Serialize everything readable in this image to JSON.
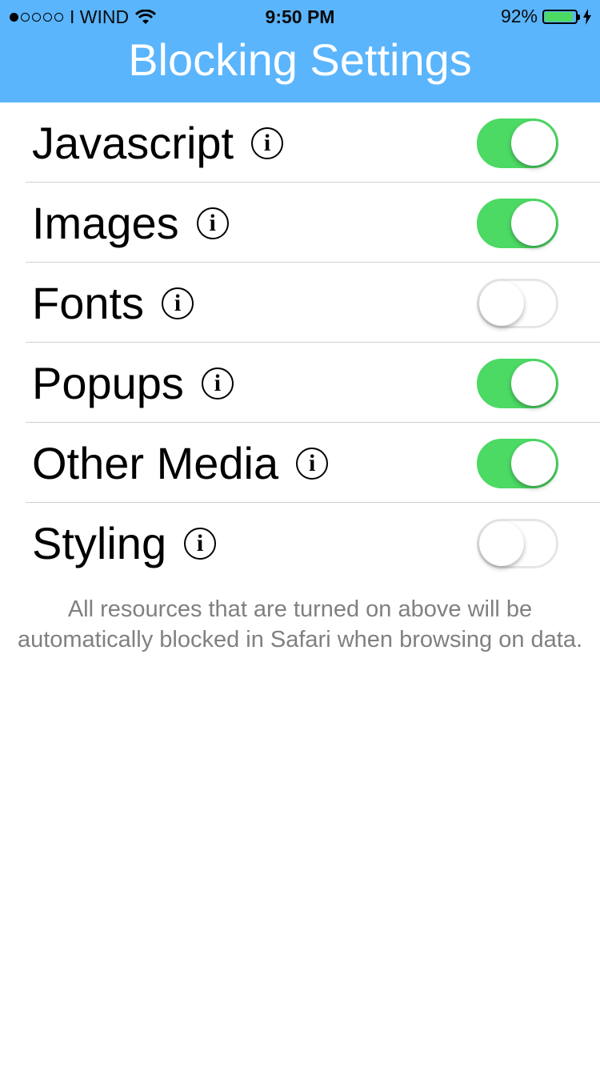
{
  "status_bar": {
    "carrier": "I WIND",
    "time": "9:50 PM",
    "battery_percent": "92%",
    "battery_level": 0.92,
    "signal_bars_filled": 1
  },
  "header": {
    "title": "Blocking Settings",
    "background": "#5ab5fd"
  },
  "settings": [
    {
      "label": "Javascript",
      "enabled": true
    },
    {
      "label": "Images",
      "enabled": true
    },
    {
      "label": "Fonts",
      "enabled": false
    },
    {
      "label": "Popups",
      "enabled": true
    },
    {
      "label": "Other Media",
      "enabled": true
    },
    {
      "label": "Styling",
      "enabled": false
    }
  ],
  "info_glyph": "i",
  "footer_text": "All resources that are turned on above will be automatically blocked in Safari when browsing on data.",
  "colors": {
    "toggle_on": "#4cd964",
    "footer_text": "#808080"
  }
}
